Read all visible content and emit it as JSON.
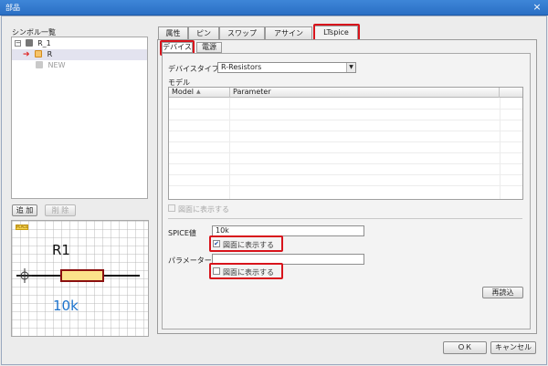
{
  "window": {
    "title": "部品",
    "close_label": "×"
  },
  "left": {
    "symbol_list_label": "シンボル一覧",
    "tree": [
      {
        "toggle": "−",
        "label": "R_1"
      },
      {
        "label": "R"
      },
      {
        "label": "NEW"
      }
    ],
    "add_label": "追 加",
    "delete_label": "削 除",
    "preview": {
      "ref": "R1",
      "value": "10k",
      "tag": "PLACE"
    }
  },
  "tabs": [
    "属性",
    "ピン",
    "スワップ",
    "アサイン",
    "LTspice"
  ],
  "subtabs": [
    "デバイス",
    "電源"
  ],
  "device": {
    "device_type_label": "デバイスタイプ",
    "device_type_value": "R-Resistors",
    "model_label": "モデル",
    "columns": [
      "Model",
      "Parameter"
    ],
    "sort_indicator": "▲",
    "show_in_drawing_disabled": "図面に表示する",
    "spice_value_label": "SPICE値",
    "spice_value": "10k",
    "spice_show_label": "図面に表示する",
    "spice_show_checked": "✔",
    "parameter_label": "パラメーター",
    "parameter_value": "",
    "param_show_label": "図面に表示する",
    "reload_label": "再読込"
  },
  "footer": {
    "ok_label": "ＯＫ",
    "cancel_label": "キャンセル"
  },
  "colors": {
    "highlight": "#d8141c",
    "value_blue": "#1b72cc",
    "titlebar": "#2a6fc4"
  }
}
